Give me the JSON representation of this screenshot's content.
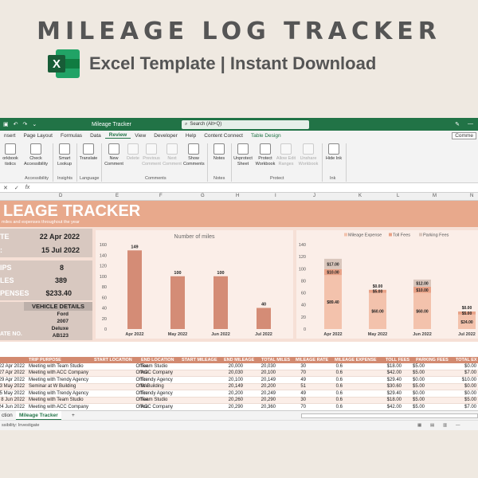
{
  "hero": {
    "title": "MILEAGE LOG TRACKER",
    "subtitle": "Excel Template | Instant Download",
    "logo_letter": "X"
  },
  "titlebar": {
    "doc_name": "Mileage Tracker",
    "search_placeholder": "Search (Alt+Q)"
  },
  "menu": {
    "items": [
      "nsert",
      "Page Layout",
      "Formulas",
      "Data",
      "Review",
      "View",
      "Developer",
      "Help",
      "Content Connect",
      "Table Design"
    ],
    "active": "Review",
    "comments": "Comme"
  },
  "ribbon": {
    "buttons": [
      "orkbook tistics",
      "Check Accessibility",
      "Smart Lookup",
      "Translate",
      "New Comment",
      "Delete",
      "Previous Comment",
      "Next Comment",
      "Show Comments",
      "Notes",
      "Unprotect Sheet",
      "Protect Workbook",
      "Allow Edit Ranges",
      "Unshare Workbook",
      "Hide Ink"
    ],
    "groups": [
      "Accessibility",
      "Insights",
      "Language",
      "Comments",
      "Notes",
      "Protect",
      "Ink"
    ]
  },
  "formula_bar": {
    "fx": "fx",
    "cancel": "✕",
    "confirm": "✓"
  },
  "columns": [
    "D",
    "E",
    "F",
    "G",
    "H",
    "I",
    "J",
    "K",
    "L",
    "M",
    "N"
  ],
  "banner": {
    "title": "LEAGE TRACKER",
    "subtitle": "miles and expenses throughout the year"
  },
  "summary": {
    "start_label": "TE",
    "start_value": "22 Apr 2022",
    "end_label": ":",
    "end_value": "15 Jul 2022",
    "trips_label": "IPS",
    "trips_value": "8",
    "miles_label": "LES",
    "miles_value": "389",
    "expenses_label": "PENSES",
    "expenses_value": "$233.40"
  },
  "vehicle": {
    "header": "VEHICLE DETAILS",
    "make": "Ford",
    "year": "2007",
    "trim": "Deluxe",
    "plate_label": "ATE NO.",
    "plate": "AB123"
  },
  "chart_data": [
    {
      "type": "bar",
      "title": "Number of miles",
      "categories": [
        "Apr 2022",
        "May 2022",
        "Jun 2022",
        "Jul 2022"
      ],
      "values": [
        149,
        100,
        100,
        40
      ],
      "ylim": [
        0,
        160
      ],
      "yticks": [
        "0",
        "20",
        "40",
        "60",
        "80",
        "100",
        "120",
        "140",
        "160"
      ],
      "bar_color": "#d48c76"
    },
    {
      "type": "bar",
      "stacked": true,
      "categories": [
        "Apr 2022",
        "May 2022",
        "Jun 2022",
        "Jul 2022"
      ],
      "series": [
        {
          "name": "Mileage Expense",
          "values": [
            89.4,
            60,
            60,
            24
          ],
          "labels": [
            "$89.40",
            "$60.00",
            "$60.00",
            "$24.00"
          ],
          "color": "#f3c2ac"
        },
        {
          "name": "Toll Fees",
          "values": [
            10,
            5,
            10,
            5
          ],
          "labels": [
            "$10.00",
            "$5.00",
            "$10.00",
            "$5.00"
          ],
          "color": "#e8a287"
        },
        {
          "name": "Parking Fees",
          "values": [
            17,
            0,
            12,
            0
          ],
          "labels": [
            "$17.00",
            "$0.00",
            "$12.00",
            "$0.00"
          ],
          "color": "#d9c6bc"
        }
      ],
      "ylim": [
        0,
        140
      ],
      "yticks": [
        "0",
        "20",
        "40",
        "60",
        "80",
        "100",
        "120",
        "140"
      ],
      "legend": "top"
    }
  ],
  "table": {
    "headers": [
      "TRIP PURPOSE",
      "START LOCATION",
      "END LOCATION",
      "START MILEAGE",
      "END MILEAGE",
      "TOTAL MILES",
      "MILEAGE RATE",
      "MILEAGE EXPENSE",
      "TOLL FEES",
      "PARKING FEES",
      "TOTAL EX"
    ],
    "rows": [
      [
        "22 Apr 2022",
        "Meeting with Team Studio",
        "Office",
        "Team Studio",
        "20,000",
        "20,030",
        "30",
        "0.6",
        "$18.00",
        "$5.00",
        "$0.00"
      ],
      [
        "27 Apr 2022",
        "Meeting with ACC Company",
        "Office",
        "ACC Company",
        "20,030",
        "20,100",
        "70",
        "0.6",
        "$42.00",
        "$5.00",
        "$7.00"
      ],
      [
        "29 Apr 2022",
        "Meeting with Trendy Agency",
        "Office",
        "Trendy Agency",
        "20,100",
        "20,149",
        "49",
        "0.6",
        "$29.40",
        "$0.00",
        "$10.00"
      ],
      [
        "3 May 2022",
        "Seminar at W Building",
        "Office",
        "W Building",
        "20,149",
        "20,200",
        "51",
        "0.6",
        "$30.60",
        "$5.00",
        "$0.00"
      ],
      [
        "5 May 2022",
        "Meeting with Trendy Agency",
        "Office",
        "Trendy Agency",
        "20,200",
        "20,249",
        "49",
        "0.6",
        "$29.40",
        "$0.00",
        "$0.00"
      ],
      [
        "8 Jun 2022",
        "Meeting with Team Studio",
        "Office",
        "Team Studio",
        "20,260",
        "20,290",
        "30",
        "0.6",
        "$18.00",
        "$5.00",
        "$5.00"
      ],
      [
        "24 Jun 2022",
        "Meeting with ACC Company",
        "Office",
        "ACC Company",
        "20,290",
        "20,360",
        "70",
        "0.6",
        "$42.00",
        "$5.00",
        "$7.00"
      ]
    ]
  },
  "tabs": {
    "prev": "ction",
    "active": "Mileage Tracker",
    "add": "+"
  },
  "status": {
    "accessibility": "ssibility: Investigate"
  }
}
